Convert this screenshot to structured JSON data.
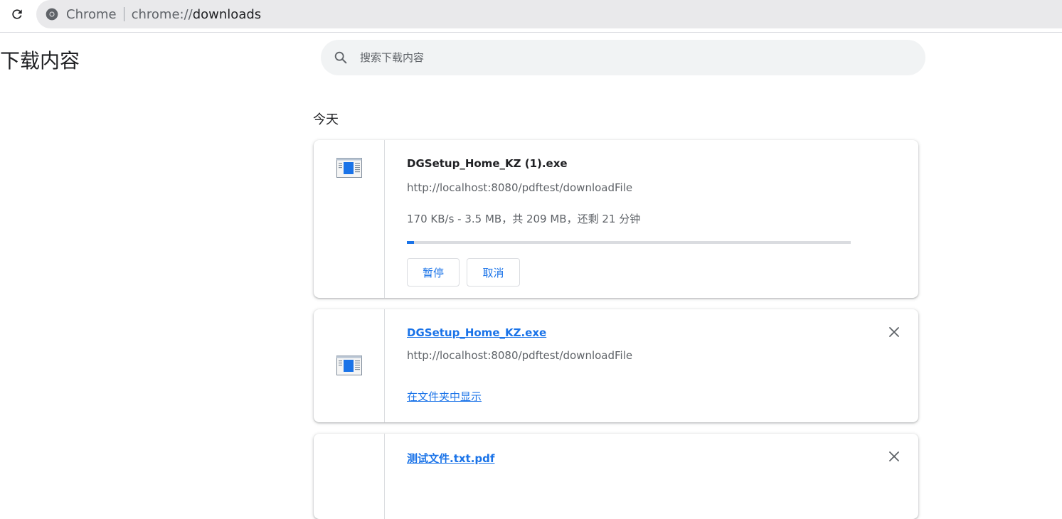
{
  "browser": {
    "site_label": "Chrome",
    "url_scheme": "chrome://",
    "url_path": "downloads",
    "reload_icon": "reload-icon",
    "logo_icon": "chrome-logo-icon"
  },
  "page": {
    "title": "下载内容",
    "search": {
      "placeholder": "搜索下载内容",
      "value": "",
      "icon": "search-icon"
    },
    "date_heading": "今天"
  },
  "downloads": [
    {
      "file_name": "DGSetup_Home_KZ (1).exe",
      "url": "http://localhost:8080/pdftest/downloadFile",
      "status": "170 KB/s - 3.5 MB，共 209 MB，还剩 21 分钟",
      "progress_fraction": 0.0167,
      "pause_label": "暂停",
      "cancel_label": "取消",
      "in_progress": true
    },
    {
      "file_name": "DGSetup_Home_KZ.exe",
      "url": "http://localhost:8080/pdftest/downloadFile",
      "show_in_folder_label": "在文件夹中显示",
      "in_progress": false
    },
    {
      "file_name": "测试文件.txt.pdf",
      "in_progress": false
    }
  ],
  "colors": {
    "accent": "#1a73e8",
    "text_primary": "#202124",
    "text_secondary": "#5f6368",
    "search_bg": "#f1f3f4",
    "omnibox_bg": "#e9e9eb",
    "divider": "#dadce0"
  }
}
